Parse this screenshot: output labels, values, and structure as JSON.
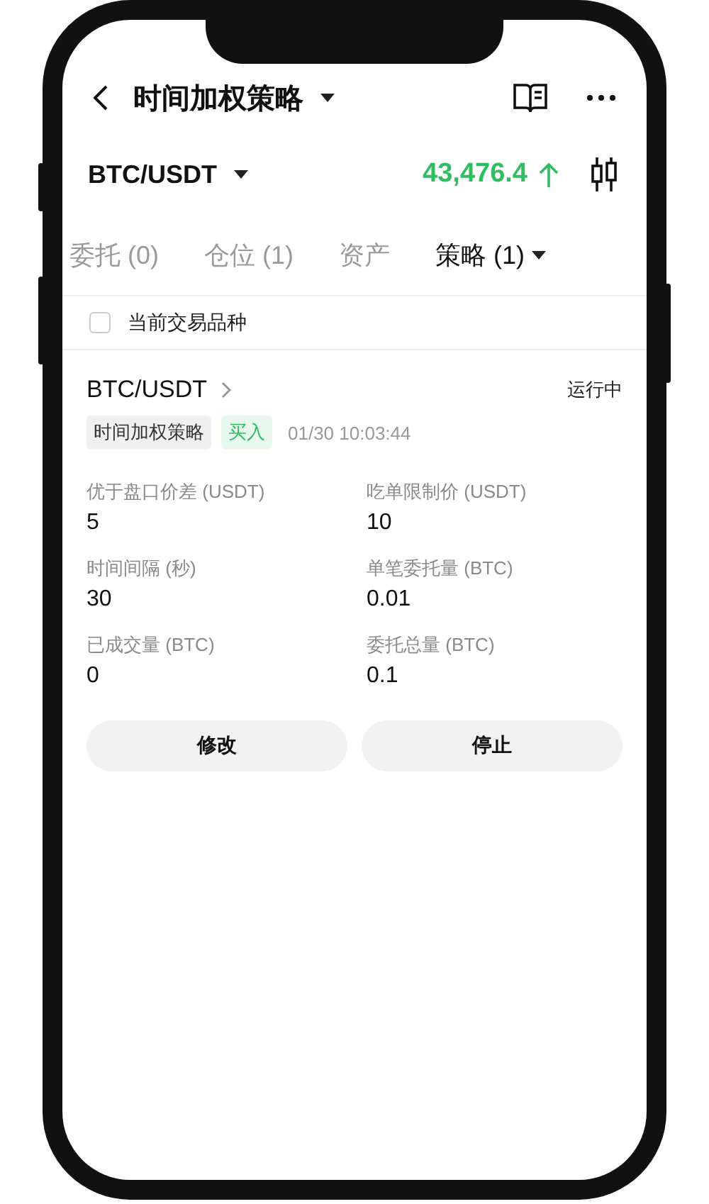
{
  "header": {
    "title": "时间加权策略"
  },
  "market": {
    "pair": "BTC/USDT",
    "price": "43,476.4",
    "rising": true
  },
  "tabs": [
    {
      "label": "委托 (0)",
      "selected": false,
      "has_menu": false
    },
    {
      "label": "仓位 (1)",
      "selected": false,
      "has_menu": false
    },
    {
      "label": "资产",
      "selected": false,
      "has_menu": false
    },
    {
      "label": "策略 (1)",
      "selected": true,
      "has_menu": true
    }
  ],
  "filter": {
    "label": "当前交易品种",
    "checked": false
  },
  "strategy": {
    "pair": "BTC/USDT",
    "status": "运行中",
    "tags": [
      {
        "text": "时间加权策略",
        "kind": "type"
      },
      {
        "text": "买入",
        "kind": "buy"
      }
    ],
    "time": "01/30 10:03:44",
    "fields": [
      {
        "label": "优于盘口价差 (USDT)",
        "value": "5"
      },
      {
        "label": "吃单限制价 (USDT)",
        "value": "10"
      },
      {
        "label": "时间间隔 (秒)",
        "value": "30"
      },
      {
        "label": "单笔委托量 (BTC)",
        "value": "0.01"
      },
      {
        "label": "已成交量 (BTC)",
        "value": "0"
      },
      {
        "label": "委托总量 (BTC)",
        "value": "0.1"
      }
    ],
    "buttons": [
      "修改",
      "停止"
    ]
  }
}
